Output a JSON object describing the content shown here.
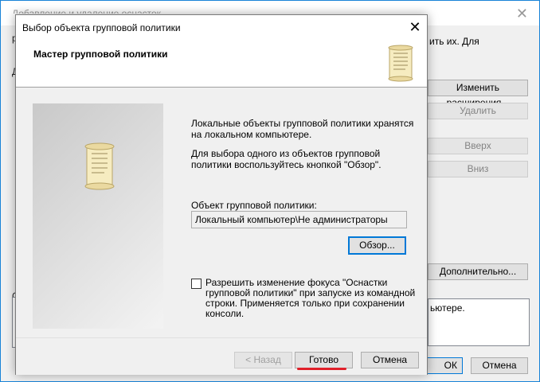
{
  "background_dialog": {
    "title": "Добавление и удаление оснасток",
    "partial_text": "ить их. Для",
    "left_chars": [
      "р",
      "Д",
      "С"
    ],
    "buttons": {
      "change_extensions": "Изменить расширения...",
      "remove": "Удалить",
      "up": "Вверх",
      "down": "Вниз",
      "advanced": "Дополнительно...",
      "ok": "ОК",
      "cancel": "Отмена"
    },
    "description_box_text": "ьютере."
  },
  "wizard": {
    "title": "Выбор объекта групповой политики",
    "header_title": "Мастер групповой политики",
    "description_1": "Локальные объекты групповой политики хранятся на локальном компьютере.",
    "description_2": "Для выбора одного из объектов групповой политики воспользуйтесь кнопкой \"Обзор\".",
    "gpo_label": "Объект групповой политики:",
    "gpo_value": "Локальный компьютер\\Не администраторы",
    "browse_button": "Обзор...",
    "checkbox_label": "Разрешить изменение фокуса \"Оснастки групповой политики\" при запуске из командной строки. Применяется только при сохранении консоли.",
    "checkbox_checked": false,
    "back_button": "< Назад",
    "finish_button": "Готово",
    "cancel_button": "Отмена",
    "close_glyph": "✕"
  },
  "colors": {
    "accent": "#0078d7",
    "highlight_underline": "#e0202a"
  }
}
